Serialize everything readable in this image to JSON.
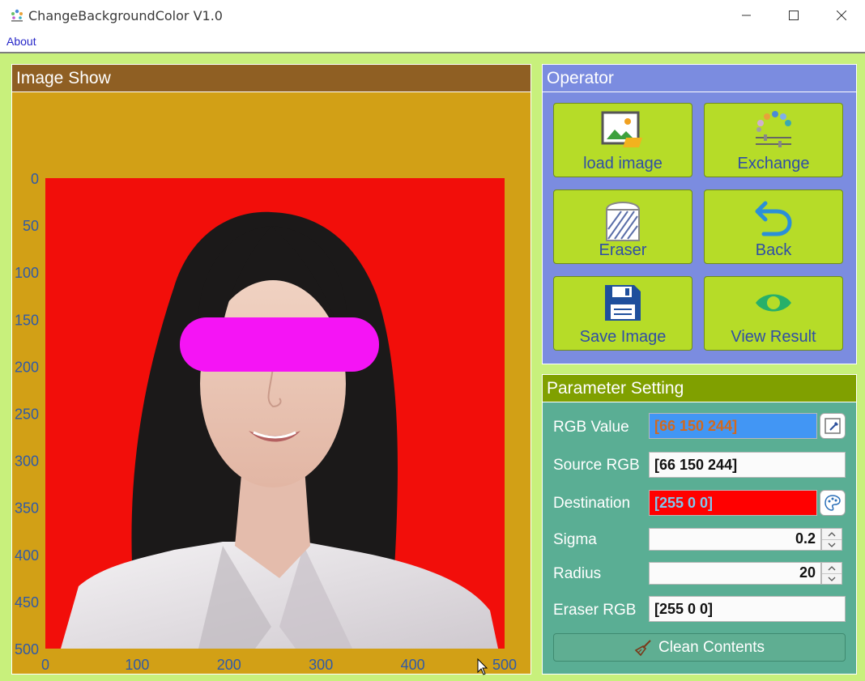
{
  "window": {
    "title": "ChangeBackgroundColor V1.0",
    "menu": [
      "About"
    ]
  },
  "image_show": {
    "title": "Image Show",
    "y_ticks": [
      "0",
      "50",
      "100",
      "150",
      "200",
      "250",
      "300",
      "350",
      "400",
      "450",
      "500"
    ],
    "x_ticks": [
      "0",
      "100",
      "200",
      "300",
      "400",
      "500"
    ]
  },
  "operator": {
    "title": "Operator",
    "buttons": [
      {
        "label": "load image",
        "icon": "load-image-icon"
      },
      {
        "label": "Exchange",
        "icon": "exchange-icon"
      },
      {
        "label": "Eraser",
        "icon": "eraser-icon"
      },
      {
        "label": "Back",
        "icon": "back-icon"
      },
      {
        "label": "Save Image",
        "icon": "save-icon"
      },
      {
        "label": "View Result",
        "icon": "view-icon"
      }
    ]
  },
  "parameters": {
    "title": "Parameter Setting",
    "rgb_value": {
      "label": "RGB Value",
      "value": "[66 150 244]"
    },
    "source_rgb": {
      "label": "Source RGB",
      "value": "[66 150 244]"
    },
    "destination": {
      "label": "Destination",
      "value": "[255 0 0]"
    },
    "sigma": {
      "label": "Sigma",
      "value": "0.2"
    },
    "radius": {
      "label": "Radius",
      "value": "20"
    },
    "eraser_rgb": {
      "label": "Eraser RGB",
      "value": "[255 0 0]"
    },
    "clean_label": "Clean Contents"
  },
  "colors": {
    "background": "#c8f07c",
    "image_panel": "#d2a016",
    "image_header": "#8f5f23",
    "photo_background": "#f20e0a",
    "operator_panel": "#7b8ce0",
    "operator_button": "#b6dc28",
    "parameter_panel": "#5aae94",
    "parameter_header": "#80a000",
    "rgb_value_fill": "#4296f4",
    "destination_fill": "#ff0000",
    "mask": "#f514f5"
  }
}
